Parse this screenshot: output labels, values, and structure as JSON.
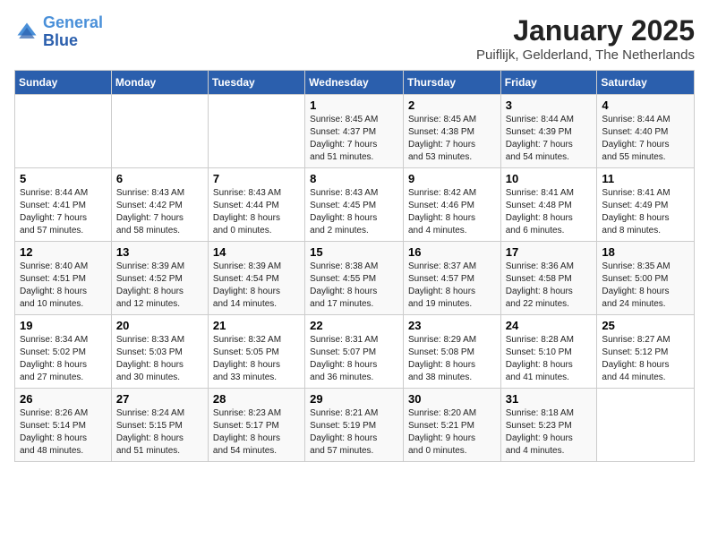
{
  "header": {
    "logo_line1": "General",
    "logo_line2": "Blue",
    "title": "January 2025",
    "subtitle": "Puiflijk, Gelderland, The Netherlands"
  },
  "weekdays": [
    "Sunday",
    "Monday",
    "Tuesday",
    "Wednesday",
    "Thursday",
    "Friday",
    "Saturday"
  ],
  "weeks": [
    [
      {
        "day": "",
        "info": ""
      },
      {
        "day": "",
        "info": ""
      },
      {
        "day": "",
        "info": ""
      },
      {
        "day": "1",
        "info": "Sunrise: 8:45 AM\nSunset: 4:37 PM\nDaylight: 7 hours\nand 51 minutes."
      },
      {
        "day": "2",
        "info": "Sunrise: 8:45 AM\nSunset: 4:38 PM\nDaylight: 7 hours\nand 53 minutes."
      },
      {
        "day": "3",
        "info": "Sunrise: 8:44 AM\nSunset: 4:39 PM\nDaylight: 7 hours\nand 54 minutes."
      },
      {
        "day": "4",
        "info": "Sunrise: 8:44 AM\nSunset: 4:40 PM\nDaylight: 7 hours\nand 55 minutes."
      }
    ],
    [
      {
        "day": "5",
        "info": "Sunrise: 8:44 AM\nSunset: 4:41 PM\nDaylight: 7 hours\nand 57 minutes."
      },
      {
        "day": "6",
        "info": "Sunrise: 8:43 AM\nSunset: 4:42 PM\nDaylight: 7 hours\nand 58 minutes."
      },
      {
        "day": "7",
        "info": "Sunrise: 8:43 AM\nSunset: 4:44 PM\nDaylight: 8 hours\nand 0 minutes."
      },
      {
        "day": "8",
        "info": "Sunrise: 8:43 AM\nSunset: 4:45 PM\nDaylight: 8 hours\nand 2 minutes."
      },
      {
        "day": "9",
        "info": "Sunrise: 8:42 AM\nSunset: 4:46 PM\nDaylight: 8 hours\nand 4 minutes."
      },
      {
        "day": "10",
        "info": "Sunrise: 8:41 AM\nSunset: 4:48 PM\nDaylight: 8 hours\nand 6 minutes."
      },
      {
        "day": "11",
        "info": "Sunrise: 8:41 AM\nSunset: 4:49 PM\nDaylight: 8 hours\nand 8 minutes."
      }
    ],
    [
      {
        "day": "12",
        "info": "Sunrise: 8:40 AM\nSunset: 4:51 PM\nDaylight: 8 hours\nand 10 minutes."
      },
      {
        "day": "13",
        "info": "Sunrise: 8:39 AM\nSunset: 4:52 PM\nDaylight: 8 hours\nand 12 minutes."
      },
      {
        "day": "14",
        "info": "Sunrise: 8:39 AM\nSunset: 4:54 PM\nDaylight: 8 hours\nand 14 minutes."
      },
      {
        "day": "15",
        "info": "Sunrise: 8:38 AM\nSunset: 4:55 PM\nDaylight: 8 hours\nand 17 minutes."
      },
      {
        "day": "16",
        "info": "Sunrise: 8:37 AM\nSunset: 4:57 PM\nDaylight: 8 hours\nand 19 minutes."
      },
      {
        "day": "17",
        "info": "Sunrise: 8:36 AM\nSunset: 4:58 PM\nDaylight: 8 hours\nand 22 minutes."
      },
      {
        "day": "18",
        "info": "Sunrise: 8:35 AM\nSunset: 5:00 PM\nDaylight: 8 hours\nand 24 minutes."
      }
    ],
    [
      {
        "day": "19",
        "info": "Sunrise: 8:34 AM\nSunset: 5:02 PM\nDaylight: 8 hours\nand 27 minutes."
      },
      {
        "day": "20",
        "info": "Sunrise: 8:33 AM\nSunset: 5:03 PM\nDaylight: 8 hours\nand 30 minutes."
      },
      {
        "day": "21",
        "info": "Sunrise: 8:32 AM\nSunset: 5:05 PM\nDaylight: 8 hours\nand 33 minutes."
      },
      {
        "day": "22",
        "info": "Sunrise: 8:31 AM\nSunset: 5:07 PM\nDaylight: 8 hours\nand 36 minutes."
      },
      {
        "day": "23",
        "info": "Sunrise: 8:29 AM\nSunset: 5:08 PM\nDaylight: 8 hours\nand 38 minutes."
      },
      {
        "day": "24",
        "info": "Sunrise: 8:28 AM\nSunset: 5:10 PM\nDaylight: 8 hours\nand 41 minutes."
      },
      {
        "day": "25",
        "info": "Sunrise: 8:27 AM\nSunset: 5:12 PM\nDaylight: 8 hours\nand 44 minutes."
      }
    ],
    [
      {
        "day": "26",
        "info": "Sunrise: 8:26 AM\nSunset: 5:14 PM\nDaylight: 8 hours\nand 48 minutes."
      },
      {
        "day": "27",
        "info": "Sunrise: 8:24 AM\nSunset: 5:15 PM\nDaylight: 8 hours\nand 51 minutes."
      },
      {
        "day": "28",
        "info": "Sunrise: 8:23 AM\nSunset: 5:17 PM\nDaylight: 8 hours\nand 54 minutes."
      },
      {
        "day": "29",
        "info": "Sunrise: 8:21 AM\nSunset: 5:19 PM\nDaylight: 8 hours\nand 57 minutes."
      },
      {
        "day": "30",
        "info": "Sunrise: 8:20 AM\nSunset: 5:21 PM\nDaylight: 9 hours\nand 0 minutes."
      },
      {
        "day": "31",
        "info": "Sunrise: 8:18 AM\nSunset: 5:23 PM\nDaylight: 9 hours\nand 4 minutes."
      },
      {
        "day": "",
        "info": ""
      }
    ]
  ]
}
